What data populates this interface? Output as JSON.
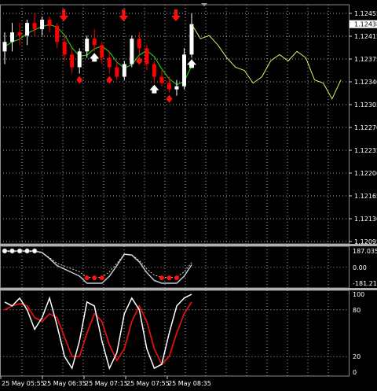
{
  "colors": {
    "background": "#000000",
    "grid": "#ffffff",
    "frame": "#8a8a8a",
    "bull": "#ffffff",
    "bear": "#ff0000",
    "forecast": "#e8ef6a",
    "ma": "#24c016",
    "cci_line": "#c8c8c8",
    "stoch_main": "#ffffff",
    "stoch_signal": "#e01010",
    "arrow_down": "#ff1010",
    "fractal_white": "#ffffff"
  },
  "main_panel": {
    "price_ticks": [
      "1.12455",
      "1.12415",
      "1.12375",
      "1.12340",
      "1.12305",
      "1.12270",
      "1.12235",
      "1.12200",
      "1.12165",
      "1.12130",
      "1.12095"
    ],
    "current_price": "1.12438",
    "x_labels": [
      "25 May 05:55",
      "25 May 06:35",
      "25 May 07:15",
      "25 May 07:55",
      "25 May 08:35"
    ]
  },
  "cci_panel": {
    "labels": [
      "187.0354",
      "0.00",
      "-181.2177"
    ]
  },
  "stoch_panel": {
    "labels": [
      "100",
      "80",
      "20",
      "0"
    ]
  },
  "chart_data": [
    {
      "type": "candlestick",
      "title": "",
      "series": [
        {
          "name": "",
          "values": [
            {
              "o": 1.12395,
              "h": 1.12425,
              "l": 1.12375,
              "c": 1.1241
            },
            {
              "o": 1.1241,
              "h": 1.1244,
              "l": 1.12395,
              "c": 1.12425
            },
            {
              "o": 1.12425,
              "h": 1.1244,
              "l": 1.12405,
              "c": 1.1242
            },
            {
              "o": 1.1242,
              "h": 1.12445,
              "l": 1.12405,
              "c": 1.1244
            },
            {
              "o": 1.1244,
              "h": 1.12455,
              "l": 1.1242,
              "c": 1.1243
            },
            {
              "o": 1.1243,
              "h": 1.1245,
              "l": 1.1242,
              "c": 1.12445
            },
            {
              "o": 1.12445,
              "h": 1.1245,
              "l": 1.12425,
              "c": 1.12435
            },
            {
              "o": 1.12435,
              "h": 1.1244,
              "l": 1.124,
              "c": 1.1241
            },
            {
              "o": 1.1241,
              "h": 1.1242,
              "l": 1.1238,
              "c": 1.1239
            },
            {
              "o": 1.1239,
              "h": 1.124,
              "l": 1.1236,
              "c": 1.1237
            },
            {
              "o": 1.1237,
              "h": 1.124,
              "l": 1.1236,
              "c": 1.12395
            },
            {
              "o": 1.12395,
              "h": 1.1242,
              "l": 1.12385,
              "c": 1.12415
            },
            {
              "o": 1.12415,
              "h": 1.1243,
              "l": 1.12395,
              "c": 1.12405
            },
            {
              "o": 1.12405,
              "h": 1.1241,
              "l": 1.12375,
              "c": 1.12385
            },
            {
              "o": 1.12385,
              "h": 1.12395,
              "l": 1.1236,
              "c": 1.1237
            },
            {
              "o": 1.1237,
              "h": 1.1238,
              "l": 1.1235,
              "c": 1.12355
            },
            {
              "o": 1.12355,
              "h": 1.1238,
              "l": 1.1235,
              "c": 1.12375
            },
            {
              "o": 1.12375,
              "h": 1.1242,
              "l": 1.1237,
              "c": 1.12415
            },
            {
              "o": 1.12415,
              "h": 1.12425,
              "l": 1.1239,
              "c": 1.124
            },
            {
              "o": 1.124,
              "h": 1.12405,
              "l": 1.12365,
              "c": 1.12375
            },
            {
              "o": 1.12375,
              "h": 1.1238,
              "l": 1.12345,
              "c": 1.12355
            },
            {
              "o": 1.12355,
              "h": 1.12365,
              "l": 1.1234,
              "c": 1.12345
            },
            {
              "o": 1.12345,
              "h": 1.12355,
              "l": 1.1233,
              "c": 1.12335
            },
            {
              "o": 1.12335,
              "h": 1.1235,
              "l": 1.12325,
              "c": 1.1234
            },
            {
              "o": 1.1234,
              "h": 1.124,
              "l": 1.12335,
              "c": 1.1239
            },
            {
              "o": 1.1239,
              "h": 1.12455,
              "l": 1.12385,
              "c": 1.12438
            }
          ]
        },
        {
          "name": "",
          "values": [
            1.12438,
            1.12415,
            1.1242,
            1.12405,
            1.12385,
            1.1237,
            1.12365,
            1.12345,
            1.12355,
            1.1238,
            1.1239,
            1.1238,
            1.12395,
            1.12385,
            1.1235,
            1.12345,
            1.1232,
            1.1235
          ]
        }
      ],
      "ylim": [
        1.1209,
        1.1246
      ]
    },
    {
      "type": "line",
      "series": [
        {
          "name": "",
          "values": [
            187,
            187,
            187,
            187,
            187,
            170,
            100,
            20,
            -20,
            -60,
            -100,
            -181,
            -181,
            -181,
            -100,
            20,
            150,
            140,
            60,
            -60,
            -150,
            -181,
            -181,
            -181,
            -100,
            30
          ]
        }
      ],
      "ylim": [
        -181.2177,
        187.0354
      ]
    },
    {
      "type": "line",
      "series": [
        {
          "name": "",
          "values": [
            90,
            85,
            95,
            80,
            55,
            70,
            95,
            60,
            20,
            5,
            40,
            90,
            85,
            40,
            5,
            25,
            75,
            95,
            80,
            30,
            5,
            10,
            50,
            85,
            95,
            100
          ]
        },
        {
          "name": "",
          "values": [
            80,
            85,
            88,
            85,
            70,
            65,
            75,
            70,
            45,
            20,
            20,
            50,
            75,
            65,
            35,
            15,
            30,
            65,
            85,
            65,
            30,
            10,
            20,
            50,
            75,
            90
          ]
        }
      ],
      "ylim": [
        0,
        100
      ]
    }
  ]
}
